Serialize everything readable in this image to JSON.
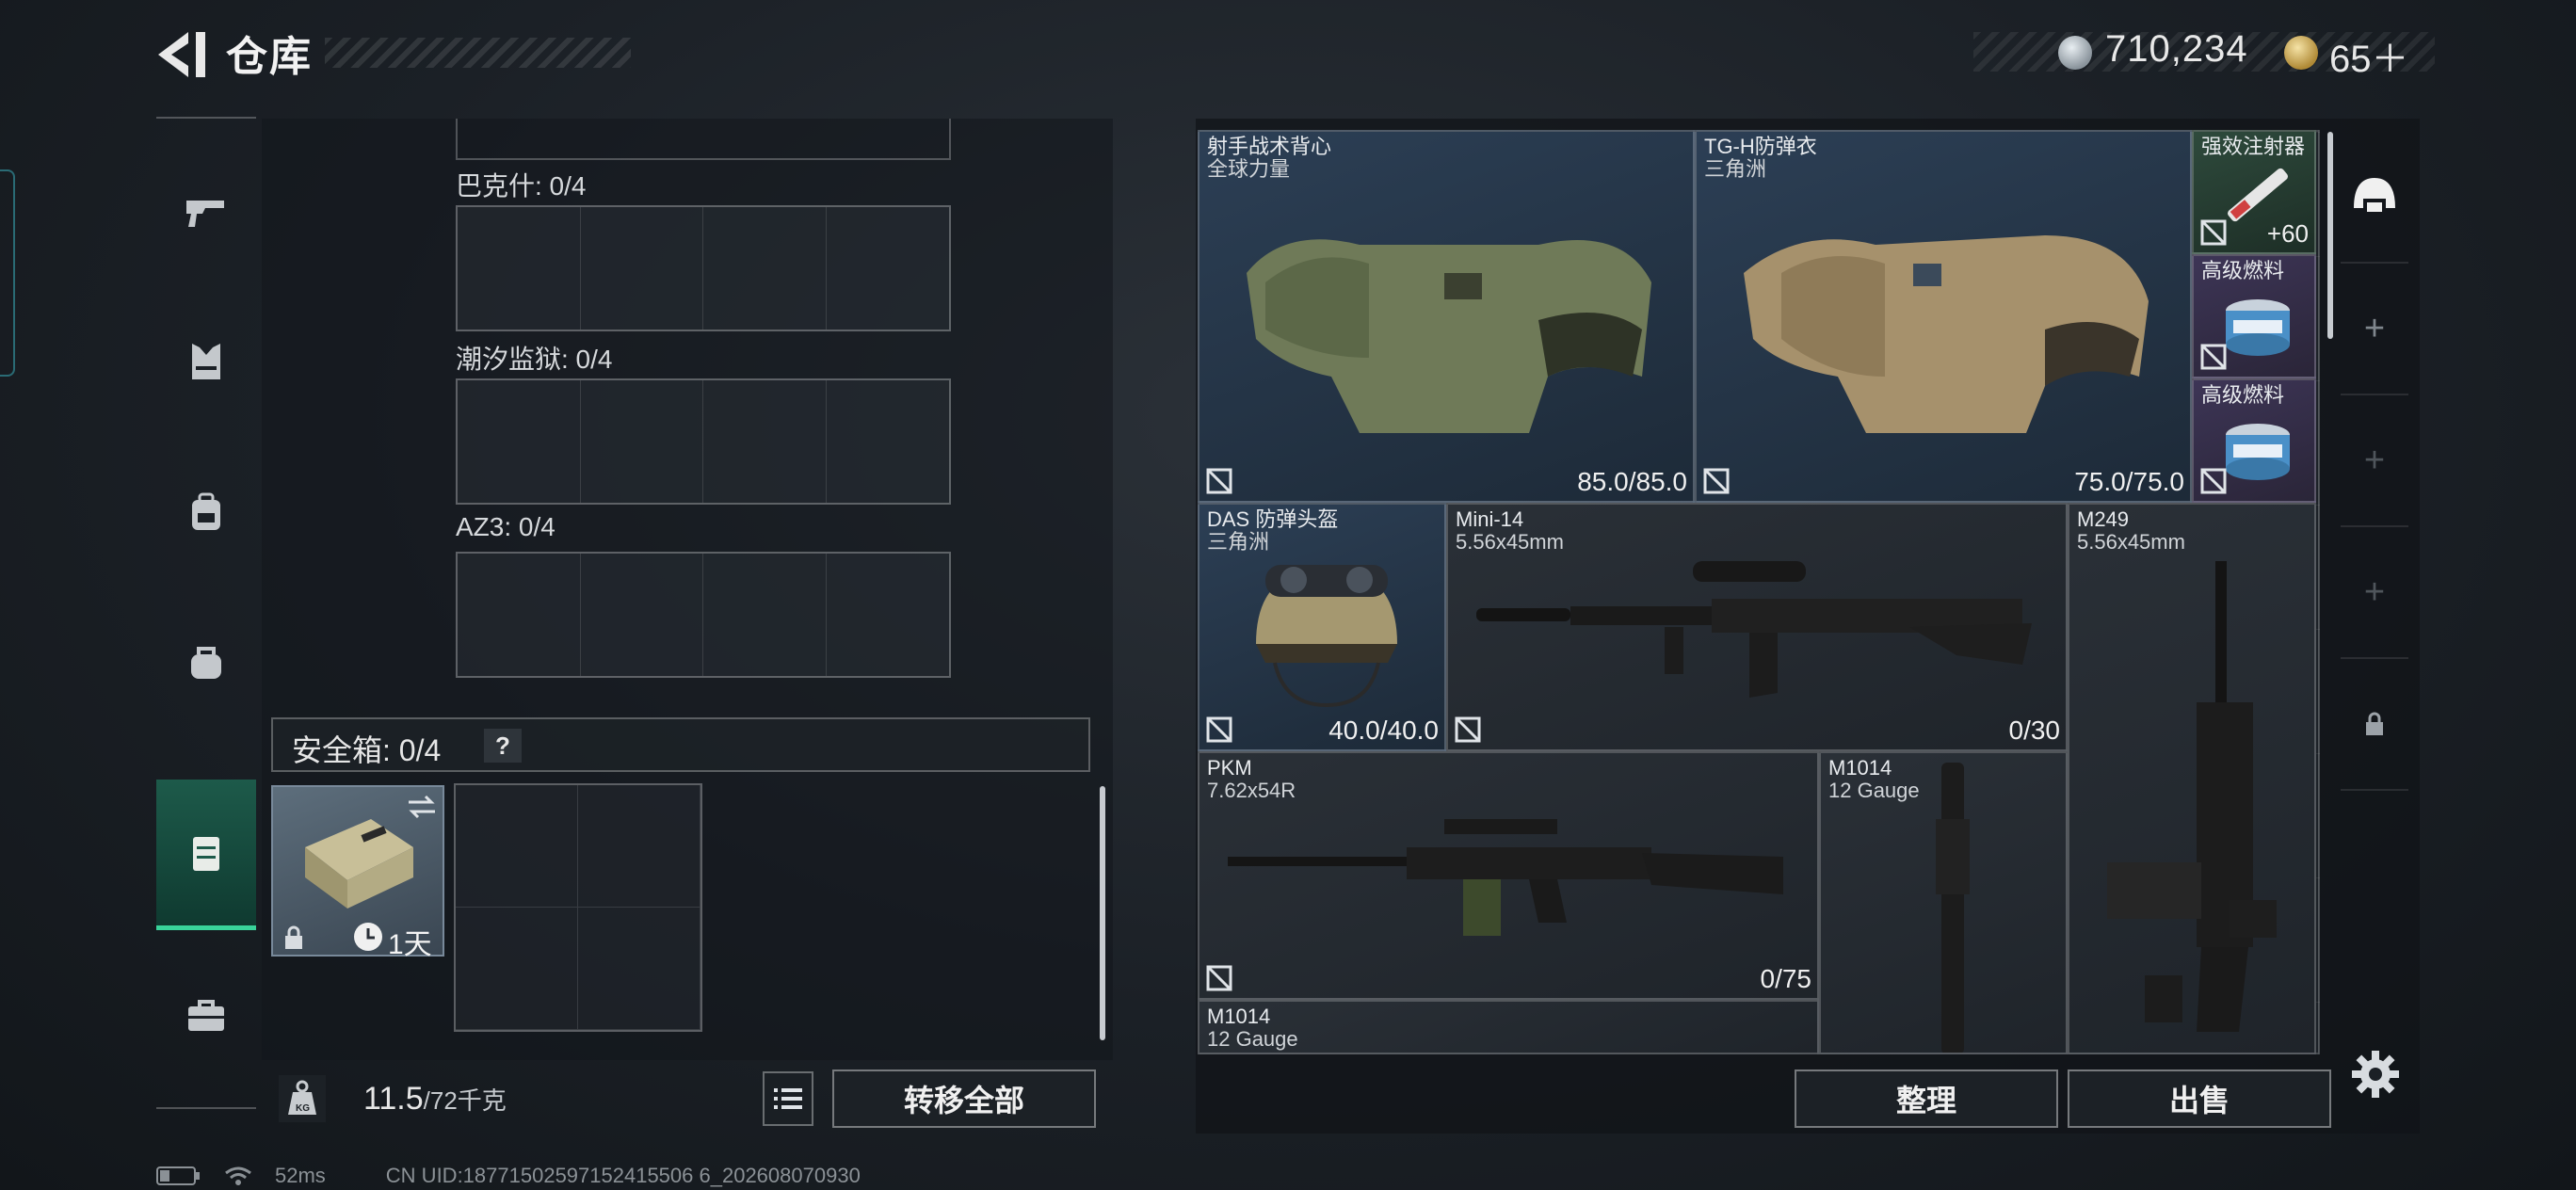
{
  "header": {
    "title": "仓库"
  },
  "currency": {
    "money": "710,234",
    "premium": "65＋"
  },
  "left_panel": {
    "rows": [
      {
        "label": "巴克什: 0/4"
      },
      {
        "label": "潮汐监狱: 0/4"
      },
      {
        "label": "AZ3: 0/4"
      }
    ],
    "safe_box": {
      "label": "安全箱: 0/4",
      "help": "?",
      "timer": "1天"
    },
    "weight": {
      "current": "11.5",
      "capacity": "/72千克"
    },
    "transfer_all": "转移全部"
  },
  "inventory": {
    "items": [
      {
        "name": "射手战术背心",
        "sub": "全球力量",
        "value": "85.0/85.0"
      },
      {
        "name": "TG-H防弹衣",
        "sub": "三角洲",
        "value": "75.0/75.0"
      },
      {
        "name": "强效注射器",
        "sub": "",
        "value": "+60"
      },
      {
        "name": "高级燃料",
        "sub": "",
        "value": ""
      },
      {
        "name": "高级燃料",
        "sub": "",
        "value": ""
      },
      {
        "name": "DAS 防弹头盔",
        "sub": "三角洲",
        "value": "40.0/40.0"
      },
      {
        "name": "Mini-14",
        "sub": "5.56x45mm",
        "value": "0/30"
      },
      {
        "name": "M249",
        "sub": "5.56x45mm",
        "value": ""
      },
      {
        "name": "PKM",
        "sub": "7.62x54R",
        "value": "0/75"
      },
      {
        "name": "M1014",
        "sub": "12 Gauge",
        "value": ""
      },
      {
        "name": "M1014",
        "sub": "12 Gauge",
        "value": ""
      }
    ],
    "sort": "整理",
    "sell": "出售"
  },
  "status": {
    "ping": "52ms",
    "uid": "CN UID:18771502597152415506 6_202608070930"
  },
  "colors": {
    "accent": "#39d39a",
    "blue_rarity": "#2c3f55",
    "purple_rarity": "#3d3556"
  }
}
